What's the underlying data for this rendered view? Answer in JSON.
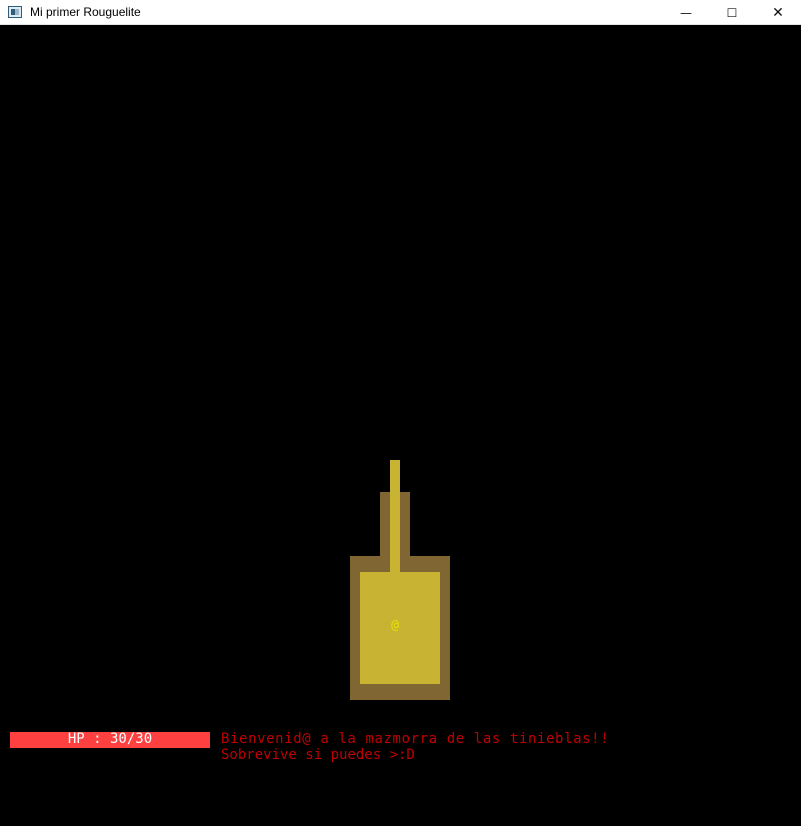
{
  "window": {
    "title": "Mi primer Rouguelite",
    "app_icon": "window-app-icon",
    "controls": {
      "minimize_glyph": "—",
      "maximize_glyph": "☐",
      "close_glyph": "✕"
    }
  },
  "game": {
    "player_glyph": "@",
    "colors": {
      "wall": "#806632",
      "floor": "#c8b332",
      "player": "#e6e400",
      "hp_bar": "#ff4040",
      "message": "#c00000"
    }
  },
  "hud": {
    "hp_label": "HP : 30/30",
    "hp_current": 30,
    "hp_max": 30
  },
  "messages": [
    "Bienvenid@ a la mazmorra de las tinieblas!!",
    "Sobrevive si puedes >:D"
  ]
}
